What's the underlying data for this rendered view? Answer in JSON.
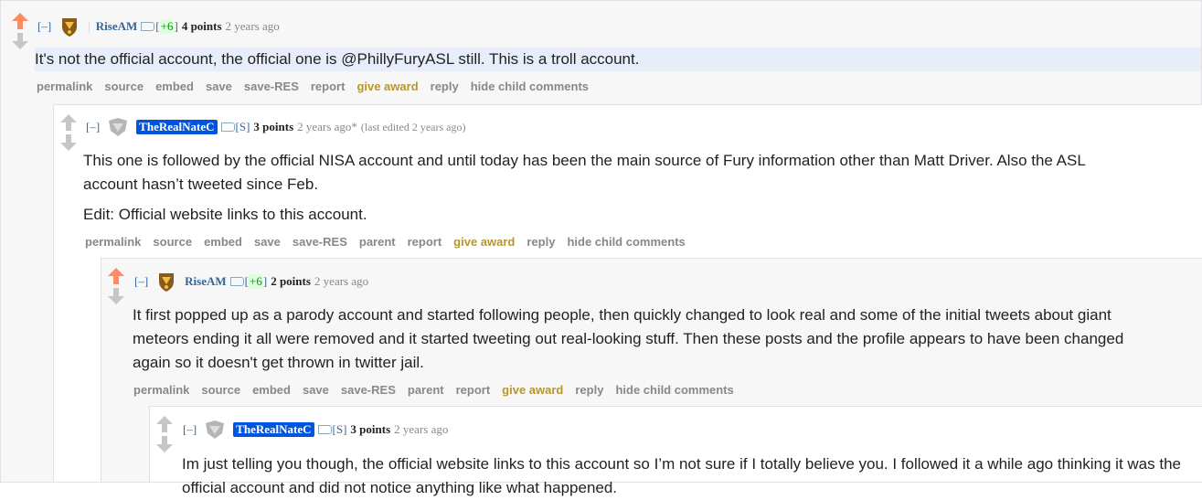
{
  "colors": {
    "upvoted": "#ff8b60",
    "neutral": "#c6c6c6",
    "author": "#336699",
    "op_bg": "#0055df",
    "award": "#b7962f"
  },
  "comments": [
    {
      "expand": "[–]",
      "author": "RiseAM",
      "flair": "+6",
      "points": "4 points",
      "time": "2 years ago",
      "paragraphs": [
        "It's not the official account, the official one is @PhillyFuryASL still. This is a troll account."
      ],
      "actions": [
        "permalink",
        "source",
        "embed",
        "save",
        "save-RES",
        "report",
        "give award",
        "reply",
        "hide child comments"
      ],
      "upvoted": true
    },
    {
      "expand": "[–]",
      "author": "TheRealNateC",
      "flair": "S",
      "points": "3 points",
      "time": "2 years ago*",
      "edited": "(last edited 2 years ago)",
      "paragraphs": [
        "This one is followed by the official NISA account and until today has been the main source of Fury information other than Matt Driver. Also the ASL account hasn’t tweeted since Feb.",
        "Edit: Official website links to this account."
      ],
      "actions": [
        "permalink",
        "source",
        "embed",
        "save",
        "save-RES",
        "parent",
        "report",
        "give award",
        "reply",
        "hide child comments"
      ],
      "upvoted": false
    },
    {
      "expand": "[–]",
      "author": "RiseAM",
      "flair": "+6",
      "points": "2 points",
      "time": "2 years ago",
      "paragraphs": [
        "It first popped up as a parody account and started following people, then quickly changed to look real and some of the initial tweets about giant meteors ending it all were removed and it started tweeting out real-looking stuff. Then these posts and the profile appears to have been changed again so it doesn't get thrown in twitter jail."
      ],
      "actions": [
        "permalink",
        "source",
        "embed",
        "save",
        "save-RES",
        "parent",
        "report",
        "give award",
        "reply",
        "hide child comments"
      ],
      "upvoted": true
    },
    {
      "expand": "[–]",
      "author": "TheRealNateC",
      "flair": "S",
      "points": "3 points",
      "time": "2 years ago",
      "paragraphs": [
        "Im just telling you though, the official website links to this account so I’m not sure if I totally believe you. I followed it a while ago thinking it was the official account and did not notice anything like what happened."
      ],
      "actions": [],
      "upvoted": false
    }
  ]
}
